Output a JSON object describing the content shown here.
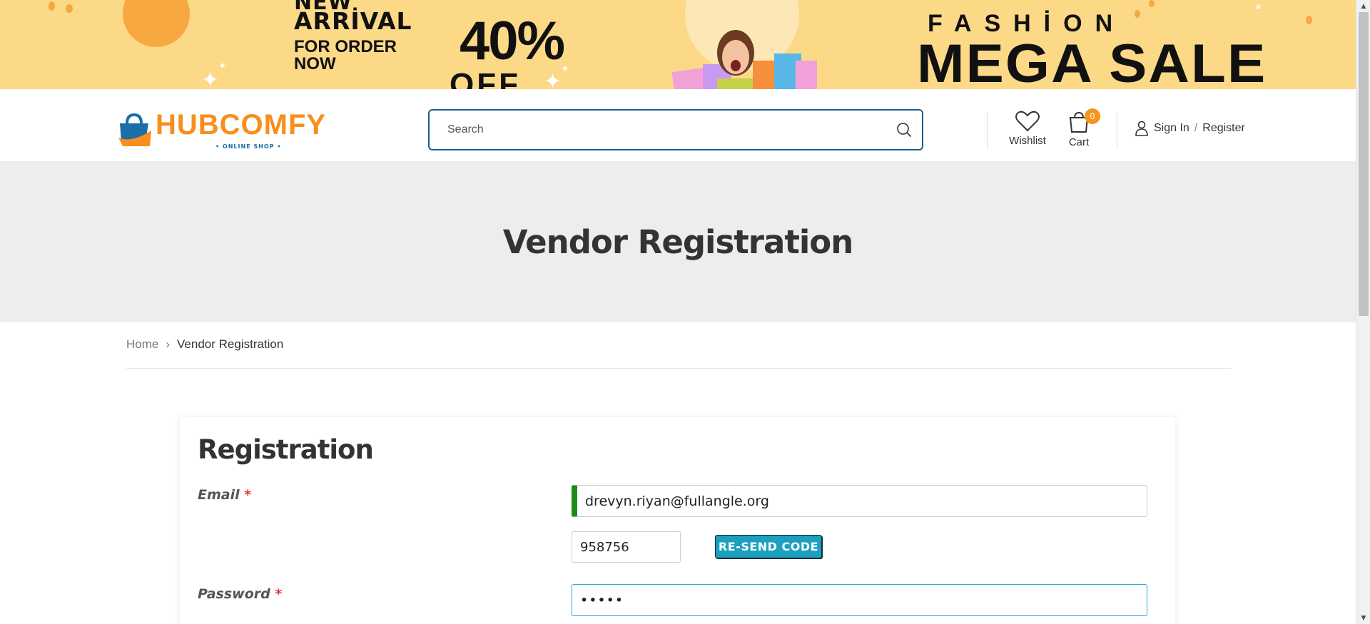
{
  "banner": {
    "new_text": "NEW",
    "arrival_text": "ARRİVAL",
    "order_line1": "FOR ORDER",
    "order_line2": "NOW",
    "discount_text": "40%",
    "off_text": "OFF",
    "fashion_text": "FASHİON",
    "mega_sale_text": "MEGA SALE"
  },
  "header": {
    "logo_text": "HUBCOMFY",
    "logo_subtext": "• ONLINE SHOP •",
    "search_placeholder": "Search",
    "wishlist_label": "Wishlist",
    "cart_label": "Cart",
    "cart_count": "0",
    "sign_in_label": "Sign In",
    "separator": "/",
    "register_label": "Register"
  },
  "page": {
    "title": "Vendor Registration"
  },
  "breadcrumb": {
    "home": "Home",
    "separator": "›",
    "current": "Vendor Registration"
  },
  "form": {
    "heading": "Registration",
    "email_label": "Email",
    "email_value": "drevyn.riyan@fullangle.org",
    "code_value": "958756",
    "resend_label": "RE-SEND CODE",
    "password_label": "Password",
    "password_value": "•••••",
    "required_mark": "*"
  },
  "colors": {
    "banner_bg": "#fcd987",
    "accent_orange": "#f78e1e",
    "brand_blue": "#1b5f8c",
    "resend_btn": "#1ba0c0",
    "valid_green": "#1a8c1a",
    "required_red": "#e8303a"
  }
}
